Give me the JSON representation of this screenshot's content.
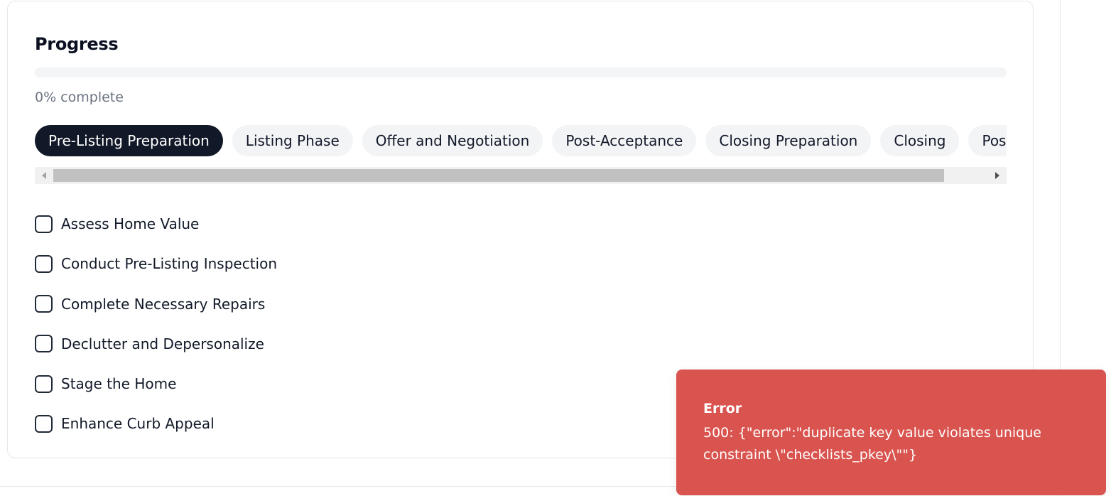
{
  "progress": {
    "title": "Progress",
    "percent": 0,
    "text": "0% complete",
    "accent_color": "#111827"
  },
  "tabs": [
    {
      "label": "Pre-Listing Preparation",
      "active": true
    },
    {
      "label": "Listing Phase",
      "active": false
    },
    {
      "label": "Offer and Negotiation",
      "active": false
    },
    {
      "label": "Post-Acceptance",
      "active": false
    },
    {
      "label": "Closing Preparation",
      "active": false
    },
    {
      "label": "Closing",
      "active": false
    },
    {
      "label": "Post-Closing",
      "active": false
    }
  ],
  "checklist": [
    {
      "label": "Assess Home Value",
      "checked": false
    },
    {
      "label": "Conduct Pre-Listing Inspection",
      "checked": false
    },
    {
      "label": "Complete Necessary Repairs",
      "checked": false
    },
    {
      "label": "Declutter and Depersonalize",
      "checked": false
    },
    {
      "label": "Stage the Home",
      "checked": false
    },
    {
      "label": "Enhance Curb Appeal",
      "checked": false
    }
  ],
  "toast": {
    "title": "Error",
    "message": "500: {\"error\":\"duplicate key value violates unique constraint \\\"checklists_pkey\\\"\"}",
    "color": "#d9534f"
  }
}
